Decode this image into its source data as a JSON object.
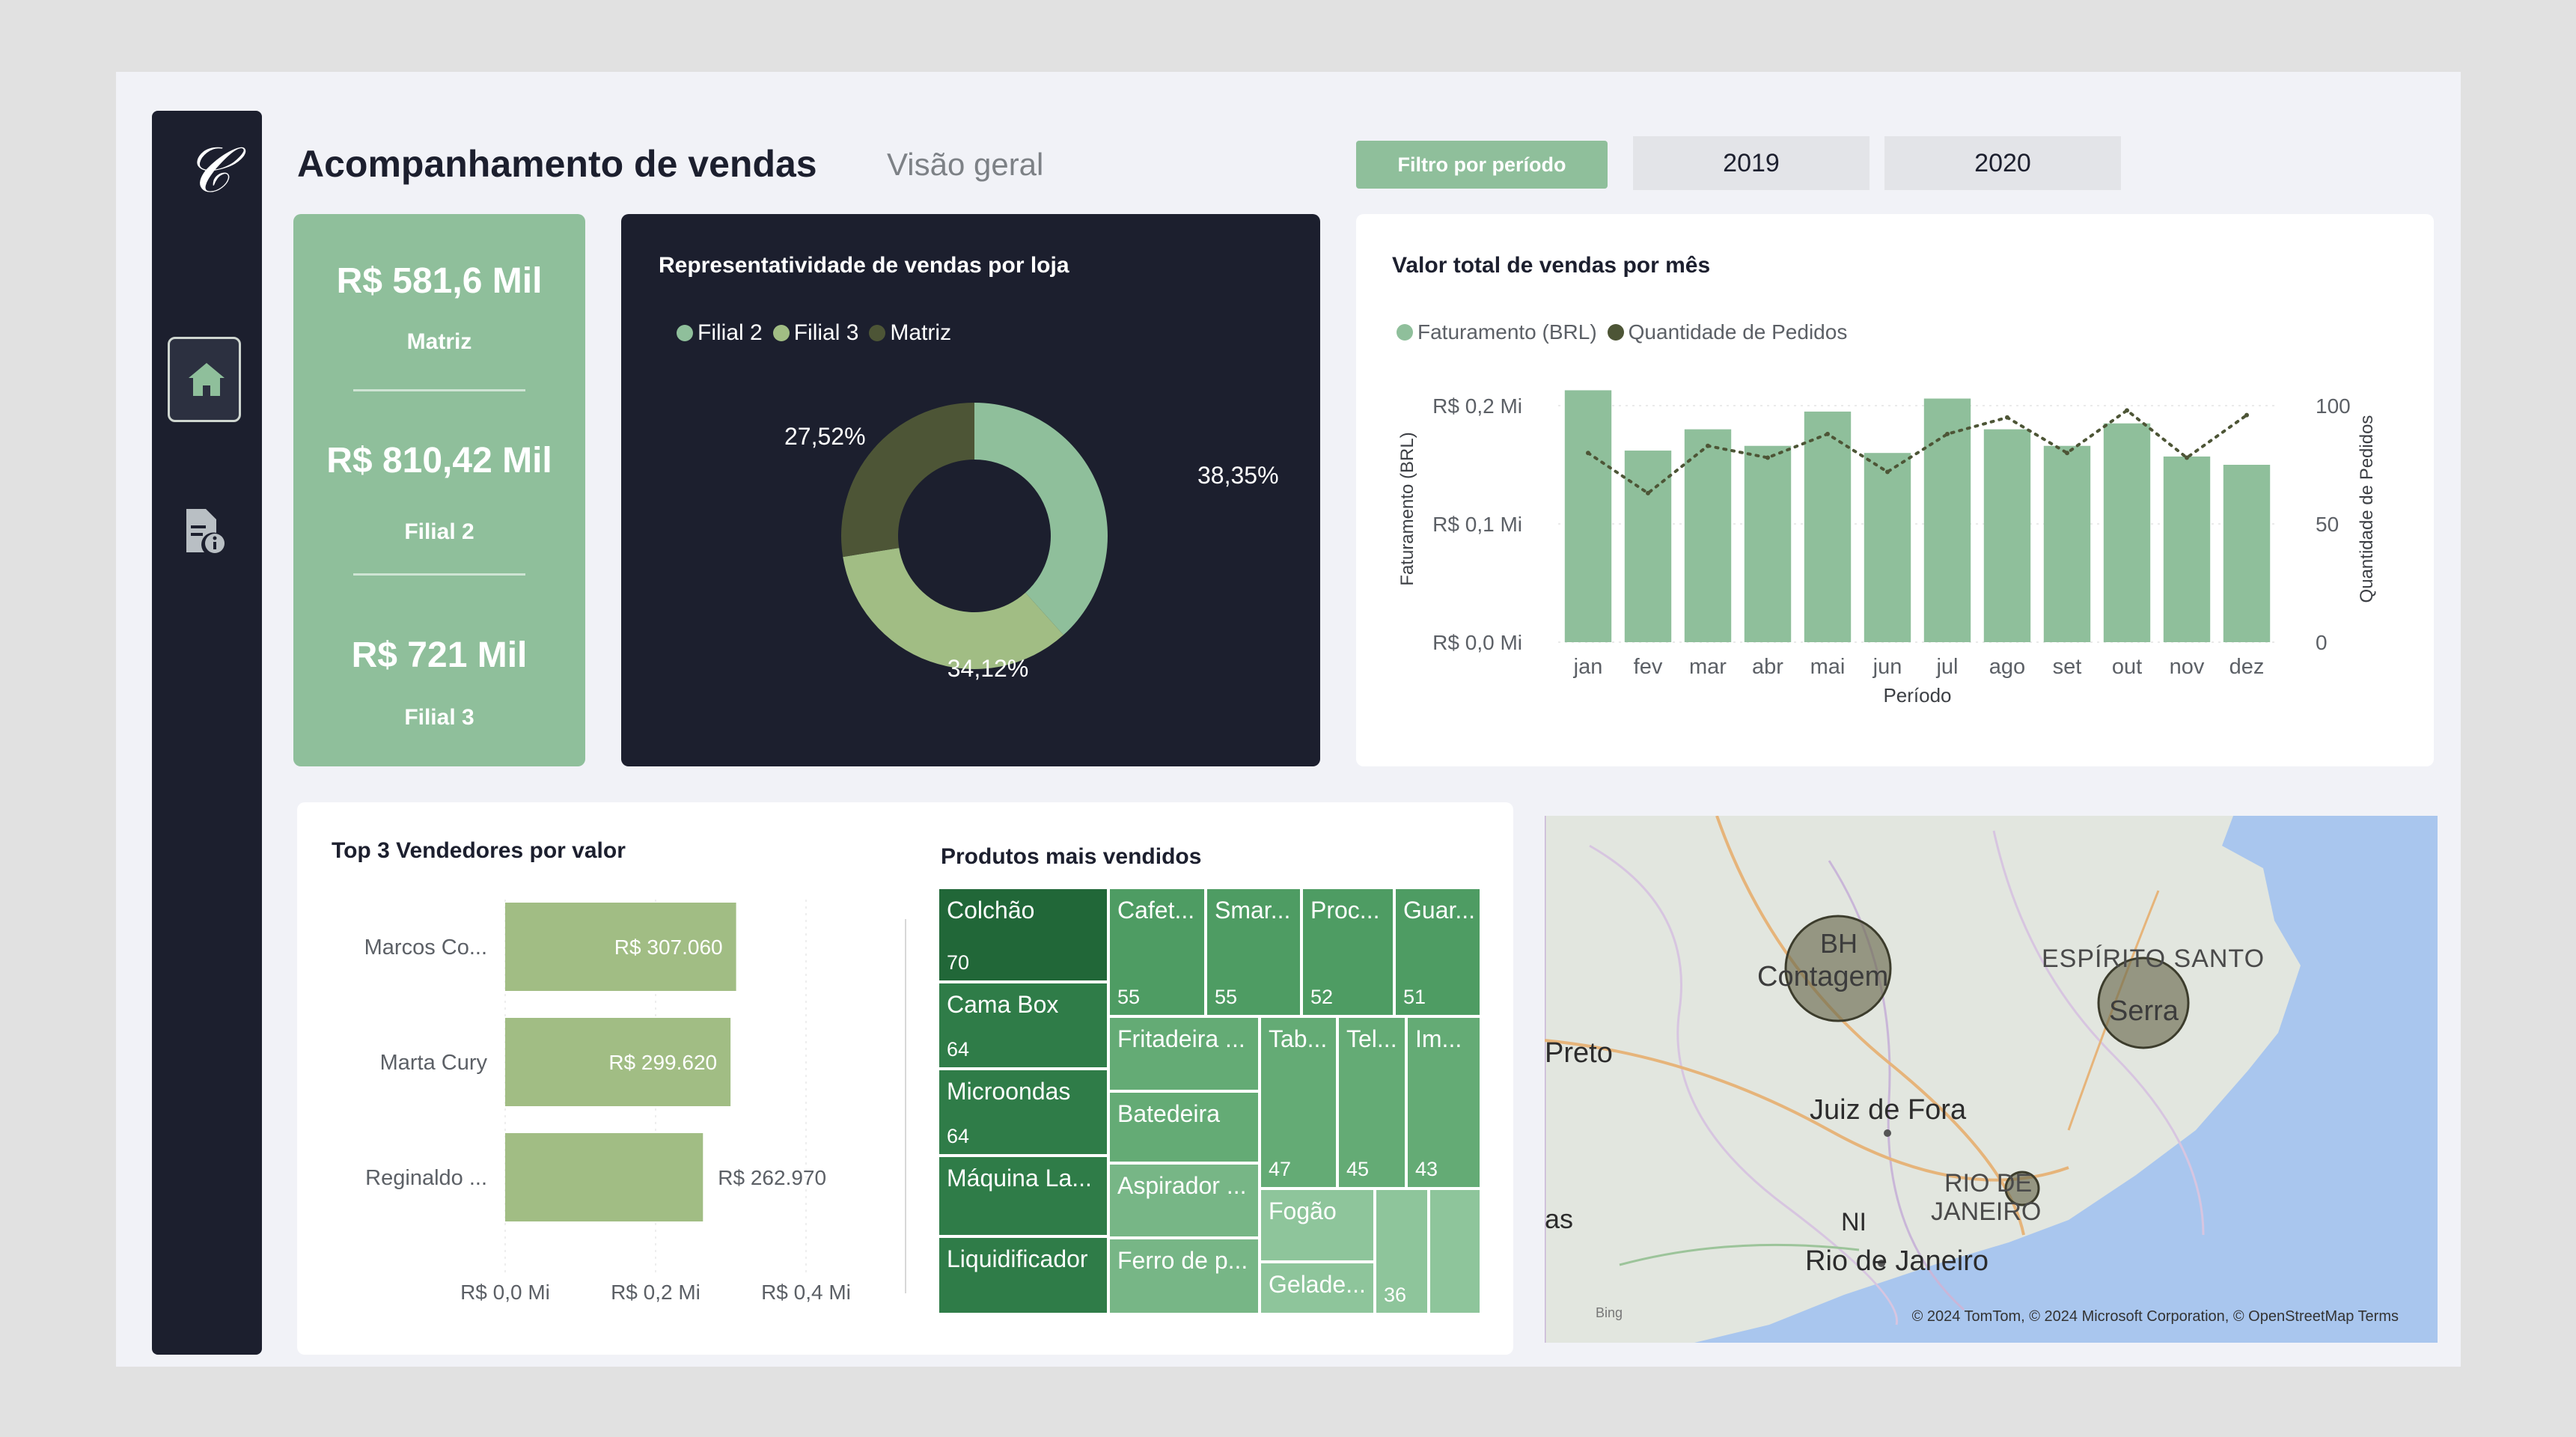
{
  "header": {
    "title": "Acompanhamento de vendas",
    "subtitle": "Visão geral"
  },
  "filter": {
    "label": "Filtro por período",
    "years": [
      "2019",
      "2020"
    ]
  },
  "nav": {
    "items": [
      "home-icon",
      "report-info-icon"
    ]
  },
  "kpis": [
    {
      "value": "R$ 581,6 Mil",
      "label": "Matriz"
    },
    {
      "value": "R$ 810,42 Mil",
      "label": "Filial 2"
    },
    {
      "value": "R$ 721 Mil",
      "label": "Filial 3"
    }
  ],
  "colors": {
    "accent": "#8fbf9b",
    "dark": "#1c1f2e",
    "filial2": "#8fbf9b",
    "filial3": "#a1bd84",
    "matriz": "#4d5536",
    "bar": "#8fbf9b",
    "line": "#4d5536"
  },
  "chart_data": [
    {
      "type": "pie",
      "title": "Representatividade de vendas por loja",
      "labels": [
        "Filial 2",
        "Filial 3",
        "Matriz"
      ],
      "values": [
        38.35,
        34.12,
        27.52
      ],
      "value_labels": [
        "38,35%",
        "34,12%",
        "27,52%"
      ]
    },
    {
      "type": "bar",
      "title": "Valor total de vendas por mês",
      "categories": [
        "jan",
        "fev",
        "mar",
        "abr",
        "mai",
        "jun",
        "jul",
        "ago",
        "set",
        "out",
        "nov",
        "dez"
      ],
      "series": [
        {
          "name": "Faturamento (BRL)",
          "type": "bar",
          "axis": "left",
          "values": [
            0.213,
            0.162,
            0.18,
            0.166,
            0.195,
            0.16,
            0.206,
            0.18,
            0.166,
            0.185,
            0.157,
            0.15
          ]
        },
        {
          "name": "Quantidade de Pedidos",
          "type": "line",
          "axis": "right",
          "values": [
            80,
            63,
            83,
            78,
            88,
            72,
            88,
            95,
            80,
            98,
            78,
            96
          ]
        }
      ],
      "xlabel": "Período",
      "ylabel": "Faturamento (BRL)",
      "y2label": "Quantidade de Pedidos",
      "ylim": [
        0,
        0.2
      ],
      "y2lim": [
        0,
        100
      ],
      "yticks": [
        "R$ 0,0 Mi",
        "R$ 0,1 Mi",
        "R$ 0,2 Mi"
      ],
      "y2ticks": [
        "0",
        "50",
        "100"
      ],
      "legend": "top-left"
    },
    {
      "type": "bar",
      "orientation": "horizontal",
      "title": "Top 3 Vendedores por valor",
      "categories": [
        "Marcos Co...",
        "Marta Cury",
        "Reginaldo ..."
      ],
      "values": [
        307060,
        299620,
        262970
      ],
      "value_labels": [
        "R$ 307.060",
        "R$ 299.620",
        "R$ 262.970"
      ],
      "xticks": [
        "R$ 0,0 Mi",
        "R$ 0,2 Mi",
        "R$ 0,4 Mi"
      ],
      "xlim": [
        0,
        400000
      ]
    },
    {
      "type": "treemap",
      "title": "Produtos mais vendidos",
      "items": [
        {
          "name": "Colchão",
          "value": "70"
        },
        {
          "name": "Cama Box",
          "value": "64"
        },
        {
          "name": "Microondas",
          "value": "64"
        },
        {
          "name": "Máquina La...",
          "value": ""
        },
        {
          "name": "Liquidificador",
          "value": ""
        },
        {
          "name": "Cafet...",
          "value": "55"
        },
        {
          "name": "Smar...",
          "value": "55"
        },
        {
          "name": "Proc...",
          "value": "52"
        },
        {
          "name": "Guar...",
          "value": "51"
        },
        {
          "name": "Fritadeira ...",
          "value": ""
        },
        {
          "name": "Batedeira",
          "value": ""
        },
        {
          "name": "Aspirador ...",
          "value": ""
        },
        {
          "name": "Ferro de p...",
          "value": ""
        },
        {
          "name": "Tab...",
          "value": "47"
        },
        {
          "name": "Tel...",
          "value": "45"
        },
        {
          "name": "Im...",
          "value": "43"
        },
        {
          "name": "Fogão",
          "value": ""
        },
        {
          "name": "Gelade...",
          "value": ""
        },
        {
          "name": "",
          "value": "36"
        },
        {
          "name": "",
          "value": ""
        }
      ]
    }
  ],
  "map": {
    "labels": [
      "BH",
      "Contagem",
      "ESPÍRITO SANTO",
      "Serra",
      "Preto",
      "Juiz de Fora",
      "RIO DE",
      "JANEIRO",
      "Rio de Janeiro",
      "NI",
      "as"
    ],
    "attribution": "© 2024 TomTom, © 2024 Microsoft Corporation, © OpenStreetMap  Terms",
    "bing": "Bing"
  }
}
